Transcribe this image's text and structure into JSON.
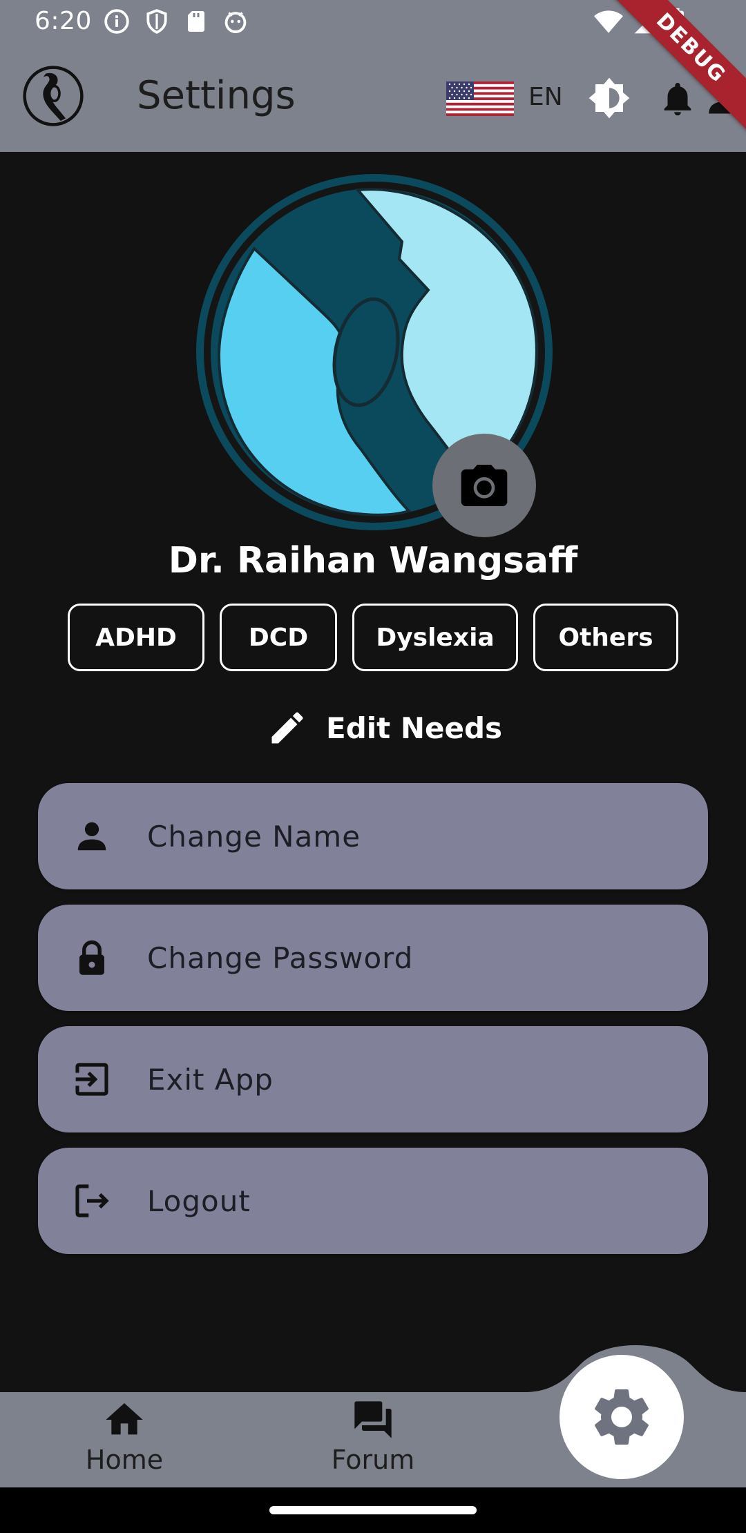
{
  "status_bar": {
    "time": "6:20"
  },
  "app_bar": {
    "title": "Settings",
    "language": "EN"
  },
  "debug_banner": "DEBUG",
  "profile": {
    "name": "Dr. Raihan Wangsaff",
    "needs": [
      "ADHD",
      "DCD",
      "Dyslexia",
      "Others"
    ],
    "edit_needs_label": "Edit Needs"
  },
  "menu": {
    "change_name": "Change Name",
    "change_password": "Change Password",
    "exit_app": "Exit App",
    "logout": "Logout"
  },
  "bottom_nav": {
    "home": "Home",
    "forum": "Forum"
  },
  "colors": {
    "background": "#121212",
    "bar": "#7d828c",
    "menu_item": "#82819a",
    "logo_dark": "#0b4a5c",
    "logo_light": "#a5e6f5",
    "logo_mid": "#57cff0"
  }
}
